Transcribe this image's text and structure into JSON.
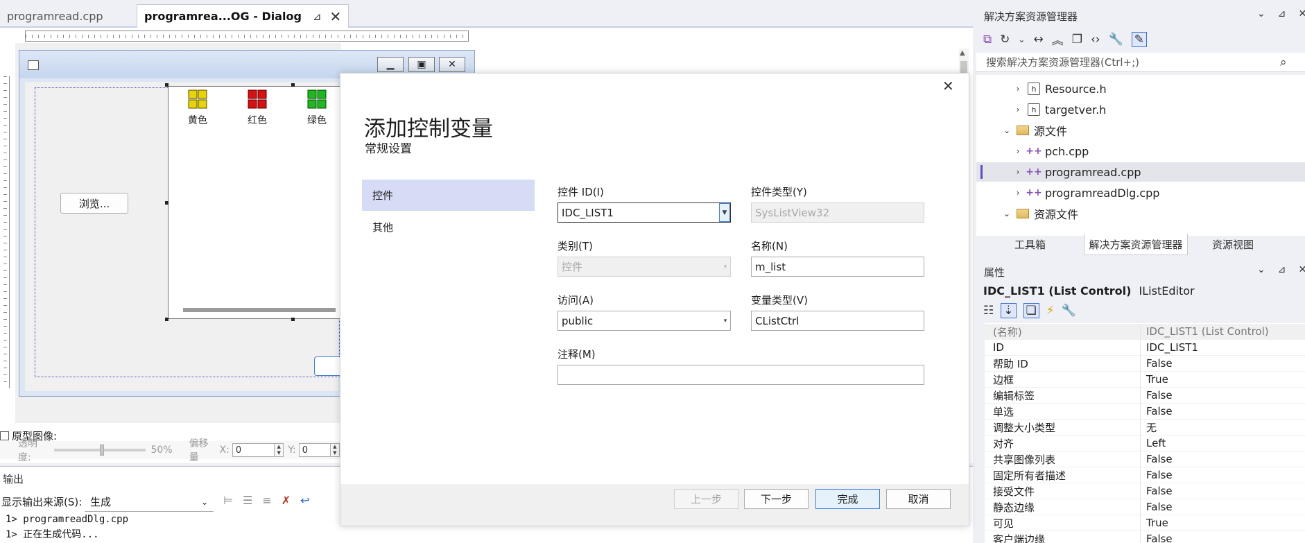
{
  "tabs": [
    {
      "label": "programread.cpp"
    },
    {
      "label": "programrea...OG - Dialog"
    }
  ],
  "icons": {
    "pin": "pin-icon",
    "close": "close-icon",
    "more": "more-icon",
    "gear": "gear-icon",
    "search": "search-icon",
    "chevron_down": "chevron-down-icon",
    "chevron_right": "chevron-right-icon"
  },
  "designer": {
    "browse_button": "浏览...",
    "list_items": [
      {
        "label": "黄色",
        "color": "#e8d400"
      },
      {
        "label": "红色",
        "color": "#d81010"
      },
      {
        "label": "绿色",
        "color": "#20b820"
      }
    ],
    "proto_image_label": "原型图像:",
    "transparency_label": "透明度:",
    "transparency_value": "50%",
    "offset_label": "偏移量",
    "x_label": "X:",
    "x_value": "0",
    "y_label": "Y:",
    "y_value": "0"
  },
  "output": {
    "title": "输出",
    "source_label": "显示输出来源(S):",
    "source_value": "生成",
    "lines": [
      "1>  programreadDlg.cpp",
      "1>  正在生成代码..."
    ]
  },
  "modal": {
    "title": "添加控制变量",
    "subtitle": "常规设置",
    "nav": [
      "控件",
      "其他"
    ],
    "fields": {
      "control_id_label": "控件 ID(I)",
      "control_id_value": "IDC_LIST1",
      "control_type_label": "控件类型(Y)",
      "control_type_value": "SysListView32",
      "category_label": "类别(T)",
      "category_value": "控件",
      "name_label": "名称(N)",
      "name_value": "m_list",
      "access_label": "访问(A)",
      "access_value": "public",
      "var_type_label": "变量类型(V)",
      "var_type_value": "CListCtrl",
      "comment_label": "注释(M)",
      "comment_value": ""
    },
    "buttons": {
      "prev": "上一步",
      "next": "下一步",
      "finish": "完成",
      "cancel": "取消"
    }
  },
  "solution_explorer": {
    "title": "解决方案资源管理器",
    "search_placeholder": "搜索解决方案资源管理器(Ctrl+;)",
    "tree": [
      {
        "label": "Resource.h",
        "kind": "header"
      },
      {
        "label": "targetver.h",
        "kind": "header"
      },
      {
        "label": "源文件",
        "kind": "folder"
      },
      {
        "label": "pch.cpp",
        "kind": "cpp"
      },
      {
        "label": "programread.cpp",
        "kind": "cpp",
        "selected": true
      },
      {
        "label": "programreadDlg.cpp",
        "kind": "cpp"
      },
      {
        "label": "资源文件",
        "kind": "folder"
      }
    ],
    "tabs": [
      "工具箱",
      "解决方案资源管理器",
      "资源视图"
    ]
  },
  "properties": {
    "title": "属性",
    "object_name": "IDC_LIST1 (List Control)",
    "object_editor": "IListEditor",
    "rows": [
      {
        "k": "(名称)",
        "v": "IDC_LIST1 (List Control)"
      },
      {
        "k": "ID",
        "v": "IDC_LIST1"
      },
      {
        "k": "帮助 ID",
        "v": "False"
      },
      {
        "k": "边框",
        "v": "True"
      },
      {
        "k": "编辑标签",
        "v": "False"
      },
      {
        "k": "单选",
        "v": "False"
      },
      {
        "k": "调整大小类型",
        "v": "无"
      },
      {
        "k": "对齐",
        "v": "Left"
      },
      {
        "k": "共享图像列表",
        "v": "False"
      },
      {
        "k": "固定所有者描述",
        "v": "False"
      },
      {
        "k": "接受文件",
        "v": "False"
      },
      {
        "k": "静态边缘",
        "v": "False"
      },
      {
        "k": "可见",
        "v": "True"
      },
      {
        "k": "客户端边缘",
        "v": "False"
      }
    ]
  },
  "colors": {
    "accent": "#3c7fd8",
    "nav_selected": "#d6dcf5",
    "selection_indicator": "#5b4fc6"
  }
}
